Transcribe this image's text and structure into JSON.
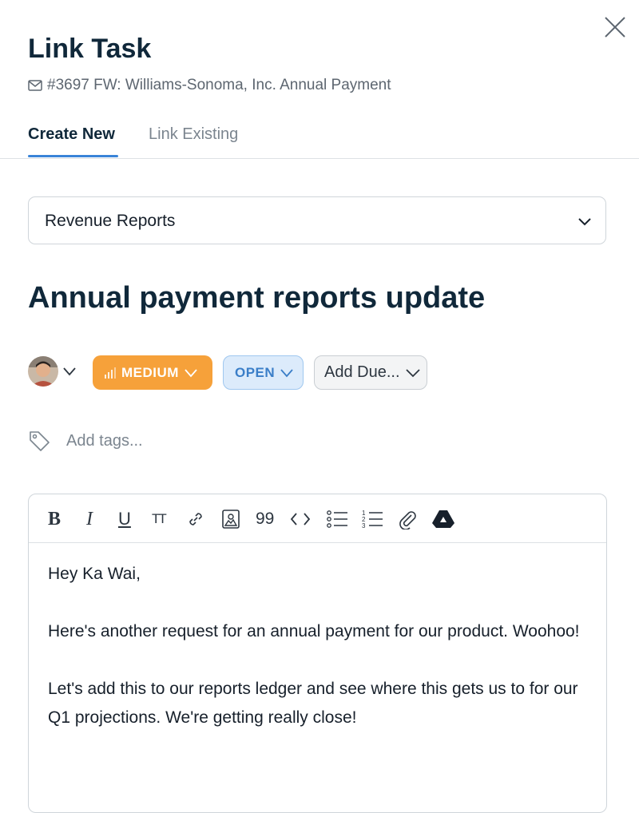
{
  "header": {
    "title": "Link Task",
    "subject": "#3697 FW: Williams-Sonoma, Inc. Annual Payment"
  },
  "tabs": [
    {
      "label": "Create New",
      "active": true
    },
    {
      "label": "Link Existing",
      "active": false
    }
  ],
  "project_select": {
    "value": "Revenue Reports"
  },
  "task": {
    "title": "Annual payment reports update"
  },
  "properties": {
    "priority": "MEDIUM",
    "status": "OPEN",
    "due": "Add Due..."
  },
  "tags": {
    "placeholder": "Add tags..."
  },
  "toolbar": {
    "bold": "B",
    "italic": "I",
    "underline": "U",
    "text_size": "TT",
    "quote": "99"
  },
  "editor": {
    "paragraphs": [
      "Hey Ka Wai,",
      "Here's another request for an annual payment for our product. Woohoo!",
      "Let's add this to our reports ledger and see where this gets us to for our Q1 projections. We're getting really close!"
    ]
  },
  "colors": {
    "accent": "#3a84d8",
    "priority_medium": "#f6a13a",
    "status_open_bg": "#dcebfb",
    "status_open_text": "#3a7ec8"
  }
}
